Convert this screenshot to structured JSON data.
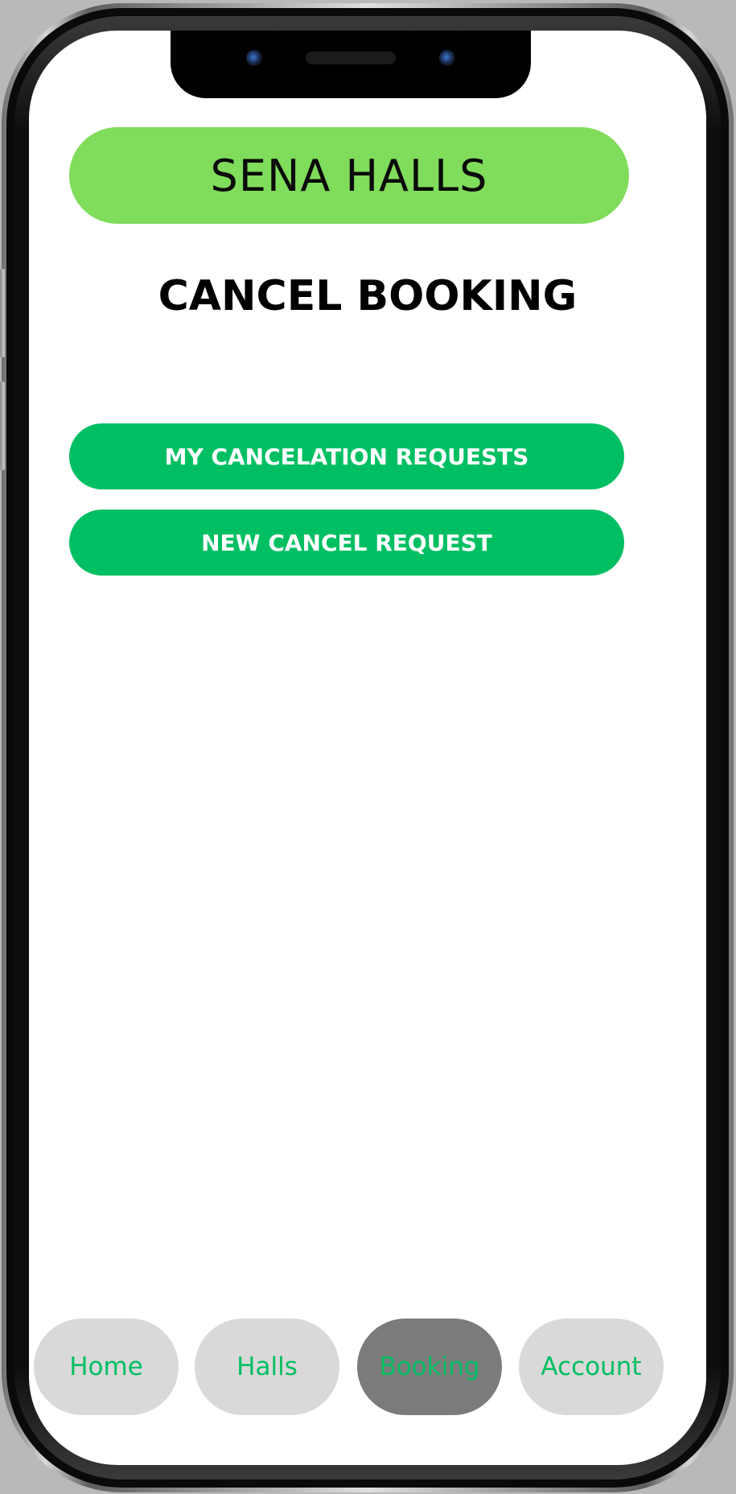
{
  "header": {
    "brand": "SENA HALLS"
  },
  "page": {
    "title": "CANCEL BOOKING"
  },
  "actions": {
    "my_requests_label": "MY CANCELATION REQUESTS",
    "new_request_label": "NEW CANCEL REQUEST"
  },
  "nav": {
    "items": [
      {
        "label": "Home",
        "active": false
      },
      {
        "label": "Halls",
        "active": false
      },
      {
        "label": "Booking",
        "active": true
      },
      {
        "label": "Account",
        "active": false
      }
    ]
  },
  "colors": {
    "brand_green": "#80dc5b",
    "action_green": "#00bf63",
    "nav_inactive": "#d9d9d9",
    "nav_active": "#7b7b7b"
  }
}
